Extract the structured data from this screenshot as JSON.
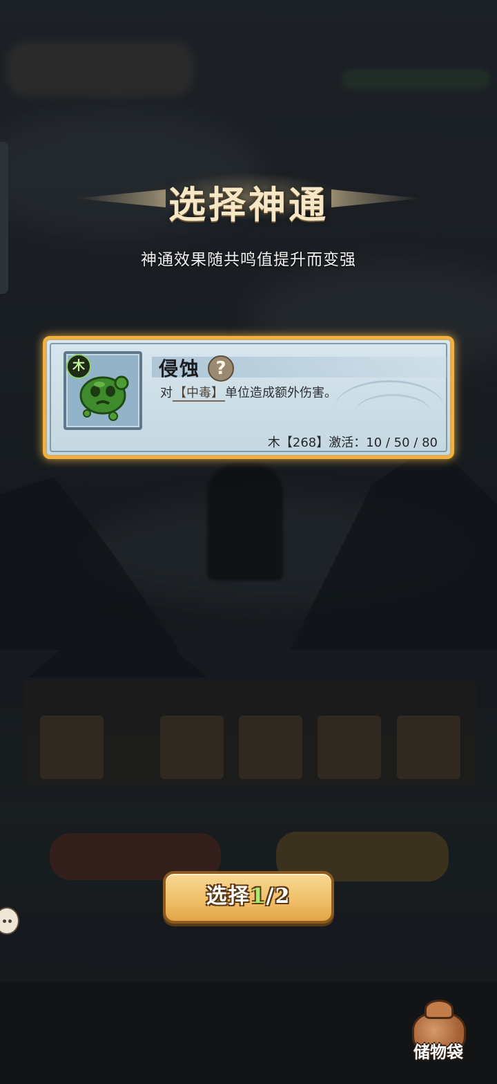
{
  "header": {
    "title": "选择神通",
    "subtitle": "神通效果随共鸣值提升而变强"
  },
  "skill_card": {
    "element": "木",
    "name": "侵蚀",
    "help_symbol": "?",
    "desc_prefix": "对",
    "desc_keyword": "【中毒】",
    "desc_suffix": "单位造成额外伤害。",
    "activation": "木【268】激活：10 / 50 / 80",
    "icon": "green-poison-slime-icon"
  },
  "select_button": {
    "label": "选择",
    "current": "1",
    "separator": "/",
    "total": "2"
  },
  "bag": {
    "label": "储物袋",
    "icon": "storage-bag-icon"
  },
  "colors": {
    "card_border": "#f3b13d",
    "button_gold": "#f0c06a",
    "element_green": "#8dd36a"
  }
}
